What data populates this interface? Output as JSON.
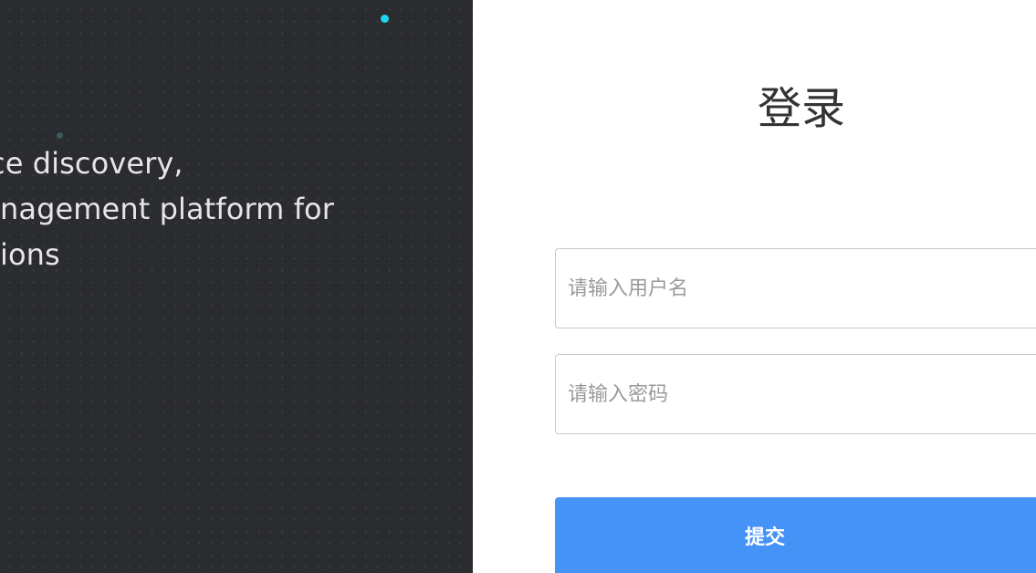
{
  "left_panel": {
    "tagline_lines": [
      "ce discovery,",
      "nagement platform for",
      "ions"
    ],
    "background_color": "#2b2c30",
    "accent_dot_color": "#1fd3ec"
  },
  "login": {
    "title": "登录",
    "username": {
      "placeholder": "请输入用户名",
      "value": ""
    },
    "password": {
      "placeholder": "请输入密码",
      "value": ""
    },
    "submit_label": "提交",
    "submit_color": "#4593f7"
  }
}
